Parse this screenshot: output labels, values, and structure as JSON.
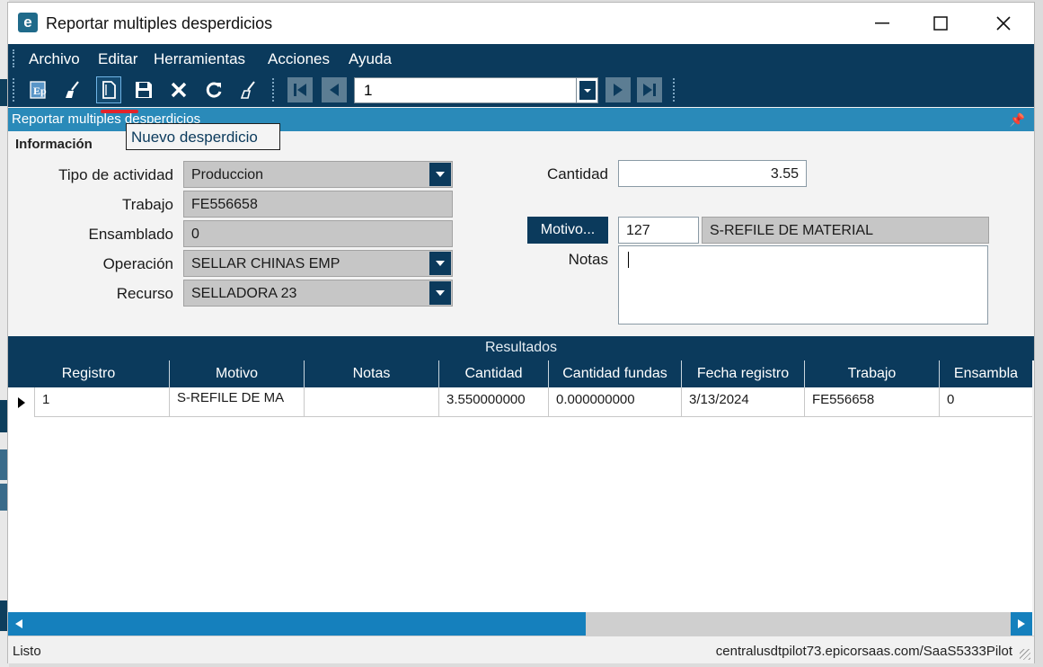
{
  "window": {
    "title": "Reportar multiples desperdicios"
  },
  "menu": [
    "Archivo",
    "Editar",
    "Herramientas",
    "Acciones",
    "Ayuda"
  ],
  "toolbar": {
    "icons": [
      "open-icon",
      "clear-icon",
      "new-icon",
      "save-icon",
      "delete-icon",
      "refresh-icon",
      "clear-brush-icon"
    ],
    "nav_value": "1",
    "tooltip": "Nuevo desperdicio"
  },
  "panel": {
    "title": "Reportar multiples desperdicios"
  },
  "form": {
    "section_title": "Información",
    "tipo_actividad_label": "Tipo de actividad",
    "tipo_actividad_value": "Produccion",
    "trabajo_label": "Trabajo",
    "trabajo_value": "FE556658",
    "ensamblado_label": "Ensamblado",
    "ensamblado_value": "0",
    "operacion_label": "Operación",
    "operacion_value": "SELLAR CHINAS EMP",
    "recurso_label": "Recurso",
    "recurso_value": "SELLADORA 23",
    "cantidad_label": "Cantidad",
    "cantidad_value": "3.55",
    "motivo_button": "Motivo...",
    "motivo_code": "127",
    "motivo_desc": "S-REFILE DE MATERIAL",
    "notas_label": "Notas",
    "notas_value": ""
  },
  "results": {
    "title": "Resultados",
    "columns": [
      "Registro",
      "Motivo",
      "Notas",
      "Cantidad",
      "Cantidad fundas",
      "Fecha registro",
      "Trabajo",
      "Ensambla"
    ],
    "rows": [
      [
        "1",
        "S-REFILE DE MA",
        "",
        "3.550000000",
        "0.000000000",
        "3/13/2024",
        "FE556658",
        "0"
      ]
    ]
  },
  "status": {
    "left": "Listo",
    "right": "centralusdtpilot73.epicorsaas.com/SaaS5333Pilot"
  },
  "colors": {
    "navy": "#0b3a5c",
    "panel_blue": "#2a8ab9",
    "scroll_blue": "#1580bd",
    "highlight_red": "#e2242b"
  }
}
